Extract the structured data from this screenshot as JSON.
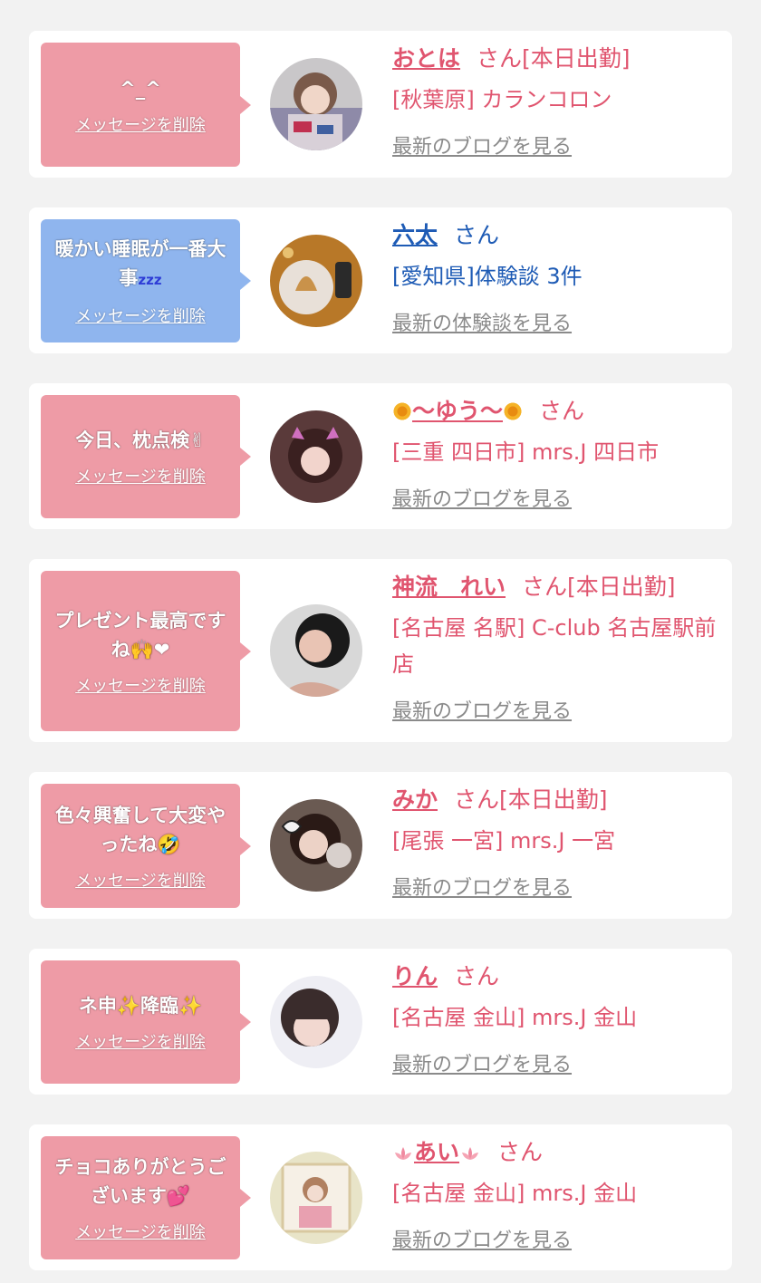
{
  "delete_label": "メッセージを削除",
  "items": [
    {
      "message": "^_^",
      "bubble_color": "pink",
      "name": "おとは",
      "suffix": "さん[本日出勤]",
      "shop": "[秋葉原] カランコロン",
      "link": "最新のブログを見る",
      "avatar": "avatar-photo-1"
    },
    {
      "message": "暖かい睡眠が一番大事",
      "message_extra": "zzz",
      "bubble_color": "blue",
      "name": "六太",
      "suffix": "さん",
      "shop": "[愛知県]体験談 3件",
      "link": "最新の体験談を見る",
      "avatar": "avatar-photo-2"
    },
    {
      "message": "今日、枕点検✌",
      "bubble_color": "pink",
      "name": "～ゆう～",
      "suffix": "さん",
      "shop": "[三重 四日市] mrs.J 四日市",
      "link": "最新のブログを見る",
      "avatar": "avatar-photo-3"
    },
    {
      "message": "プレゼント最高ですね🙌❤",
      "bubble_color": "pink",
      "name": "神流　れい",
      "suffix": "さん[本日出勤]",
      "shop": "[名古屋 名駅] C-club 名古屋駅前店",
      "link": "最新のブログを見る",
      "avatar": "avatar-photo-4"
    },
    {
      "message": "色々興奮して大変やったね🤣",
      "bubble_color": "pink",
      "name": "みか",
      "suffix": "さん[本日出勤]",
      "shop": "[尾張 一宮] mrs.J 一宮",
      "link": "最新のブログを見る",
      "avatar": "avatar-photo-5"
    },
    {
      "message": "ネ申✨降臨✨",
      "bubble_color": "pink",
      "name": "りん",
      "suffix": "さん",
      "shop": "[名古屋 金山] mrs.J 金山",
      "link": "最新のブログを見る",
      "avatar": "avatar-photo-6"
    },
    {
      "message": "チョコありがとうございます💕",
      "bubble_color": "pink",
      "name": "あい",
      "suffix": "さん",
      "shop": "[名古屋 金山] mrs.J 金山",
      "link": "最新のブログを見る",
      "avatar": "avatar-photo-7"
    }
  ],
  "colors": {
    "pink_text": "#e0556f",
    "blue_text": "#1e5bb5",
    "pink_bubble": "#ee9ba6",
    "blue_bubble": "#8fb5ee"
  }
}
